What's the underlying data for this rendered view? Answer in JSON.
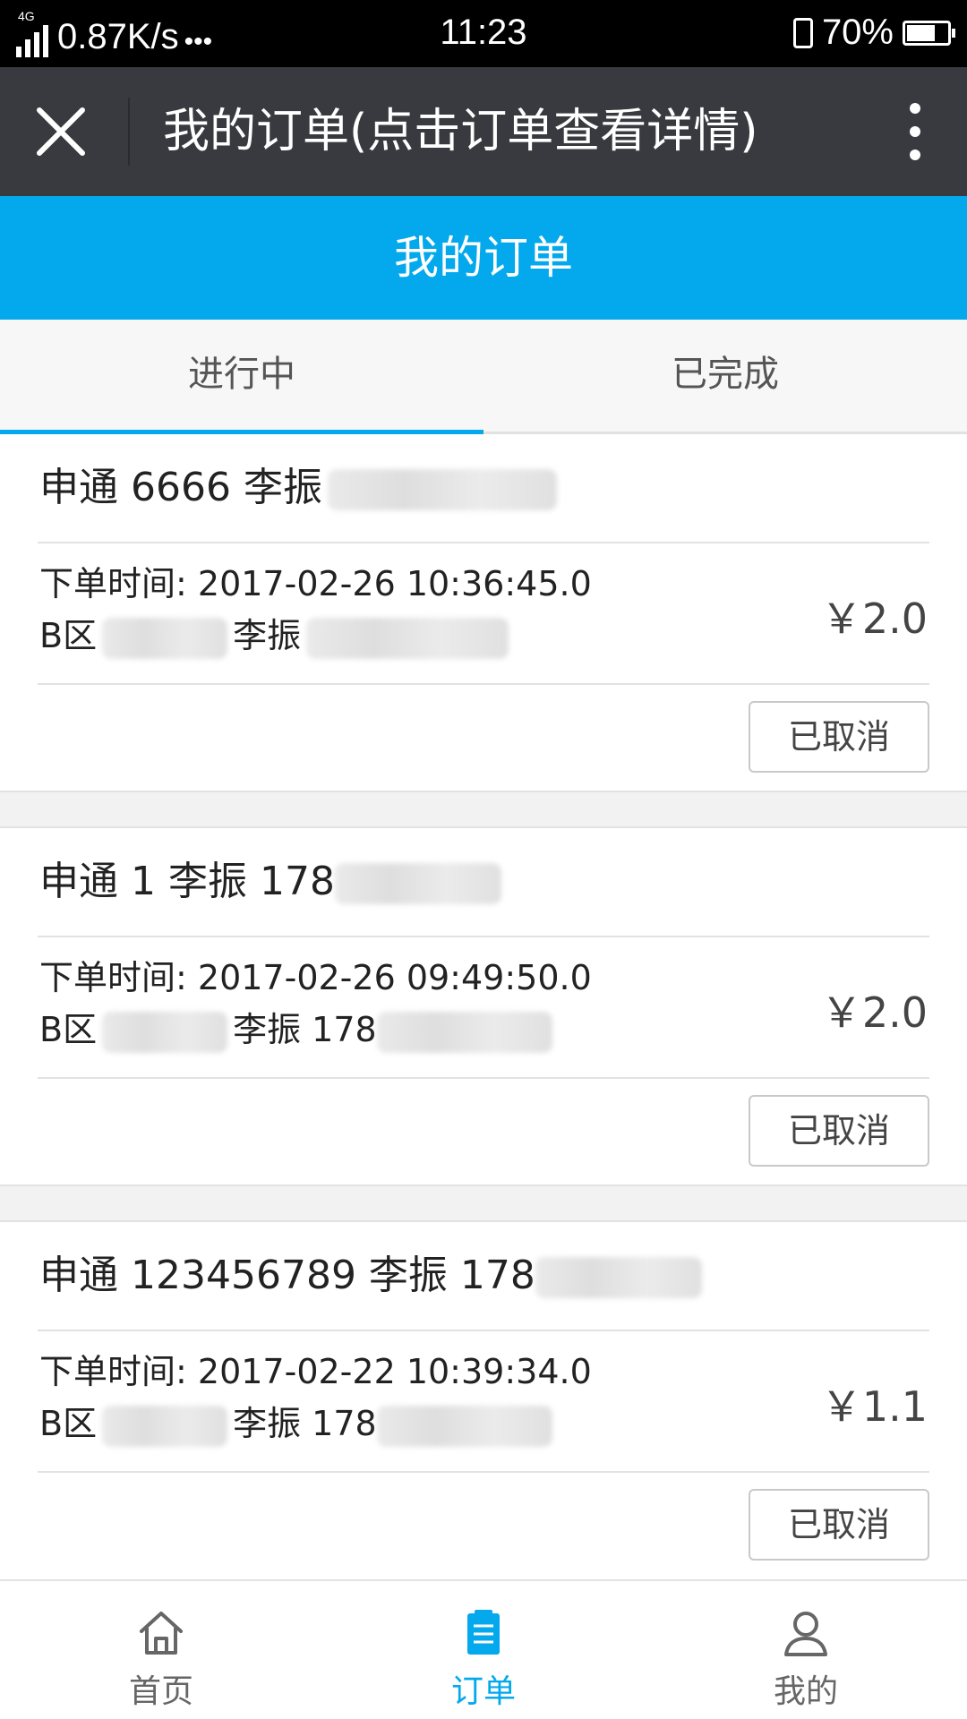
{
  "status_bar": {
    "network": "4G",
    "speed": "0.87K/s",
    "dots": "•••",
    "time": "11:23",
    "battery": "70%",
    "battery_level": 0.7
  },
  "title_bar": {
    "title": "我的订单(点击订单查看详情)"
  },
  "header": {
    "title": "我的订单"
  },
  "tabs": [
    {
      "label": "进行中",
      "active": true
    },
    {
      "label": "已完成",
      "active": false
    }
  ],
  "orders": [
    {
      "title": "申通 6666 李振",
      "time_label": "下单时间:",
      "time": "2017-02-26 10:36:45.0",
      "addr_prefix": "B区",
      "name": "李振",
      "phone_visible": "",
      "price": "￥2.0",
      "status_button": "已取消"
    },
    {
      "title": "申通 1 李振 178",
      "time_label": "下单时间:",
      "time": "2017-02-26 09:49:50.0",
      "addr_prefix": "B区",
      "name": "李振 178",
      "price": "￥2.0",
      "status_button": "已取消"
    },
    {
      "title": "申通 123456789 李振 178",
      "time_label": "下单时间:",
      "time": "2017-02-22 10:39:34.0",
      "addr_prefix": "B区",
      "name": "李振 178",
      "price": "￥1.1",
      "status_button": "已取消"
    }
  ],
  "bottom_nav": [
    {
      "label": "首页",
      "icon": "home-icon",
      "active": false
    },
    {
      "label": "订单",
      "icon": "clipboard-icon",
      "active": true
    },
    {
      "label": "我的",
      "icon": "user-icon",
      "active": false
    }
  ],
  "colors": {
    "accent": "#03a9ec",
    "titlebar": "#393a3f",
    "inactive_nav": "#666666"
  }
}
